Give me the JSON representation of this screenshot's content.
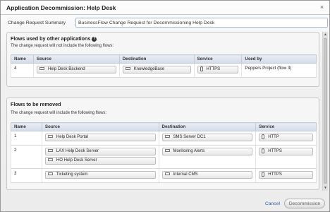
{
  "dialog": {
    "title": "Application Decommission: Help Desk",
    "close_symbol": "×"
  },
  "summary": {
    "label": "Change Request Summary",
    "value": "BusinessFlow Change Request for Decommissioning Help Desk"
  },
  "used_panel": {
    "title": "Flows used by other applications",
    "note": "The change request will not include the following flows:",
    "columns": [
      "Name",
      "Source",
      "Destination",
      "Service",
      "Used by"
    ],
    "rows": [
      {
        "name": "4",
        "sources": [
          "Help Desk Backend"
        ],
        "destinations": [
          "KnowledgeBase"
        ],
        "services": [
          "HTTPS"
        ],
        "used_by": "Peppers Project (flow 3)"
      }
    ]
  },
  "removed_panel": {
    "title": "Flows to be removed",
    "note": "The change request will include the following flows:",
    "columns": [
      "Name",
      "Source",
      "Destination",
      "Service"
    ],
    "rows": [
      {
        "name": "1",
        "sources": [
          "Help Desk Portal"
        ],
        "destinations": [
          "SMS Server DC1"
        ],
        "services": [
          "HTTP"
        ]
      },
      {
        "name": "2",
        "sources": [
          "LAX Help Desk Server",
          "HO Help Desk Server"
        ],
        "destinations": [
          "Monitoring Alerts"
        ],
        "services": [
          "HTTPS"
        ]
      },
      {
        "name": "3",
        "sources": [
          "Ticketing system"
        ],
        "destinations": [
          "Internal CMS"
        ],
        "services": [
          "HTTPS"
        ]
      }
    ]
  },
  "footer": {
    "cancel_label": "Cancel",
    "submit_label": "Decommission"
  }
}
